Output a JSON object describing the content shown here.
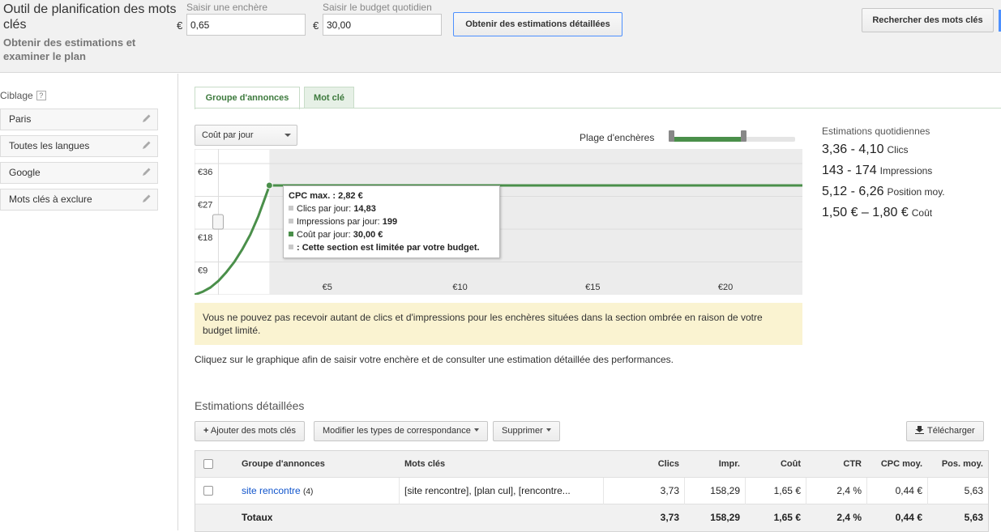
{
  "header": {
    "title": "Outil de planification des mots clés",
    "subtitle": "Obtenir des estimations et examiner le plan",
    "bid_label": "Saisir une enchère",
    "bid_currency": "€",
    "bid_value": "0,65",
    "budget_label": "Saisir le budget quotidien",
    "budget_currency": "€",
    "budget_value": "30,00",
    "estimate_button": "Obtenir des estimations détaillées",
    "search_keywords_button": "Rechercher des mots clés"
  },
  "sidebar": {
    "targeting_label": "Ciblage",
    "help": "?",
    "items": [
      {
        "label": "Paris"
      },
      {
        "label": "Toutes les langues"
      },
      {
        "label": "Google"
      },
      {
        "label": "Mots clés à exclure"
      }
    ]
  },
  "tabs": [
    {
      "label": "Groupe d'annonces",
      "active": true
    },
    {
      "label": "Mot clé",
      "active": false
    }
  ],
  "metric_select": {
    "value": "Coût par jour"
  },
  "bid_range": {
    "label": "Plage d'enchères",
    "low_fraction": 0.02,
    "high_fraction": 0.59
  },
  "chart_data": {
    "type": "line",
    "y_tick_labels": [
      "€36",
      "€27",
      "€18",
      "€9"
    ],
    "y_ticks": [
      36,
      27,
      18,
      9
    ],
    "x_tick_labels": [
      "€5",
      "€10",
      "€15",
      "€20"
    ],
    "x_ticks": [
      5,
      10,
      15,
      20
    ],
    "xlim": [
      0,
      22.9
    ],
    "ylim": [
      0,
      40
    ],
    "shaded_from_x": 2.82,
    "series": [
      {
        "color": "#4a8f4a",
        "x": [
          0,
          0.3,
          0.6,
          0.9,
          1.2,
          1.5,
          1.8,
          2.1,
          2.4,
          2.6,
          2.75,
          2.82,
          5,
          10,
          15,
          20,
          22.9
        ],
        "y": [
          0,
          0.8,
          2.0,
          3.8,
          6.2,
          9.0,
          12.5,
          16.5,
          21.5,
          25.5,
          28.5,
          30,
          30,
          30,
          30,
          30,
          30
        ]
      }
    ],
    "handle_y": 20
  },
  "tooltip": {
    "cpc_label": "CPC max. :",
    "cpc_value": "2,82 €",
    "clicks_label": "Clics par jour:",
    "clicks_value": "14,83",
    "impr_label": "Impressions par jour:",
    "impr_value": "199",
    "cost_label": "Coût par jour:",
    "cost_value": "30,00 €",
    "budget_note": ": Cette section est limitée par votre budget."
  },
  "warning": "Vous ne pouvez pas recevoir autant de clics et d'impressions pour les enchères situées dans la section ombrée en raison de votre budget limité.",
  "hint": "Cliquez sur le graphique afin de saisir votre enchère et de consulter une estimation détaillée des performances.",
  "daily_estimates": {
    "title": "Estimations quotidiennes",
    "rows": [
      {
        "value": "3,36 - 4,10",
        "label": "Clics"
      },
      {
        "value": "143 - 174",
        "label": "Impressions"
      },
      {
        "value": "5,12 - 6,26",
        "label": "Position moy."
      },
      {
        "value": "1,50 € – 1,80 €",
        "label": "Coût"
      }
    ]
  },
  "detailed": {
    "title": "Estimations détaillées",
    "add_keywords": "Ajouter des mots clés",
    "add_icon": "plus-icon",
    "match_types": "Modifier les types de correspondance",
    "delete": "Supprimer",
    "download": "Télécharger",
    "download_icon": "download-icon",
    "columns": [
      "Groupe d'annonces",
      "Mots clés",
      "Clics",
      "Impr.",
      "Coût",
      "CTR",
      "CPC moy.",
      "Pos. moy."
    ],
    "rows": [
      {
        "group": "site rencontre",
        "group_count": "(4)",
        "keywords": "[site rencontre], [plan cul], [rencontre...",
        "clicks": "3,73",
        "impr": "158,29",
        "cost": "1,65 €",
        "ctr": "2,4 %",
        "cpc": "0,44 €",
        "pos": "5,63"
      }
    ],
    "totals": {
      "label": "Totaux",
      "clicks": "3,73",
      "impr": "158,29",
      "cost": "1,65 €",
      "ctr": "2,4 %",
      "cpc": "0,44 €",
      "pos": "5,63"
    }
  }
}
